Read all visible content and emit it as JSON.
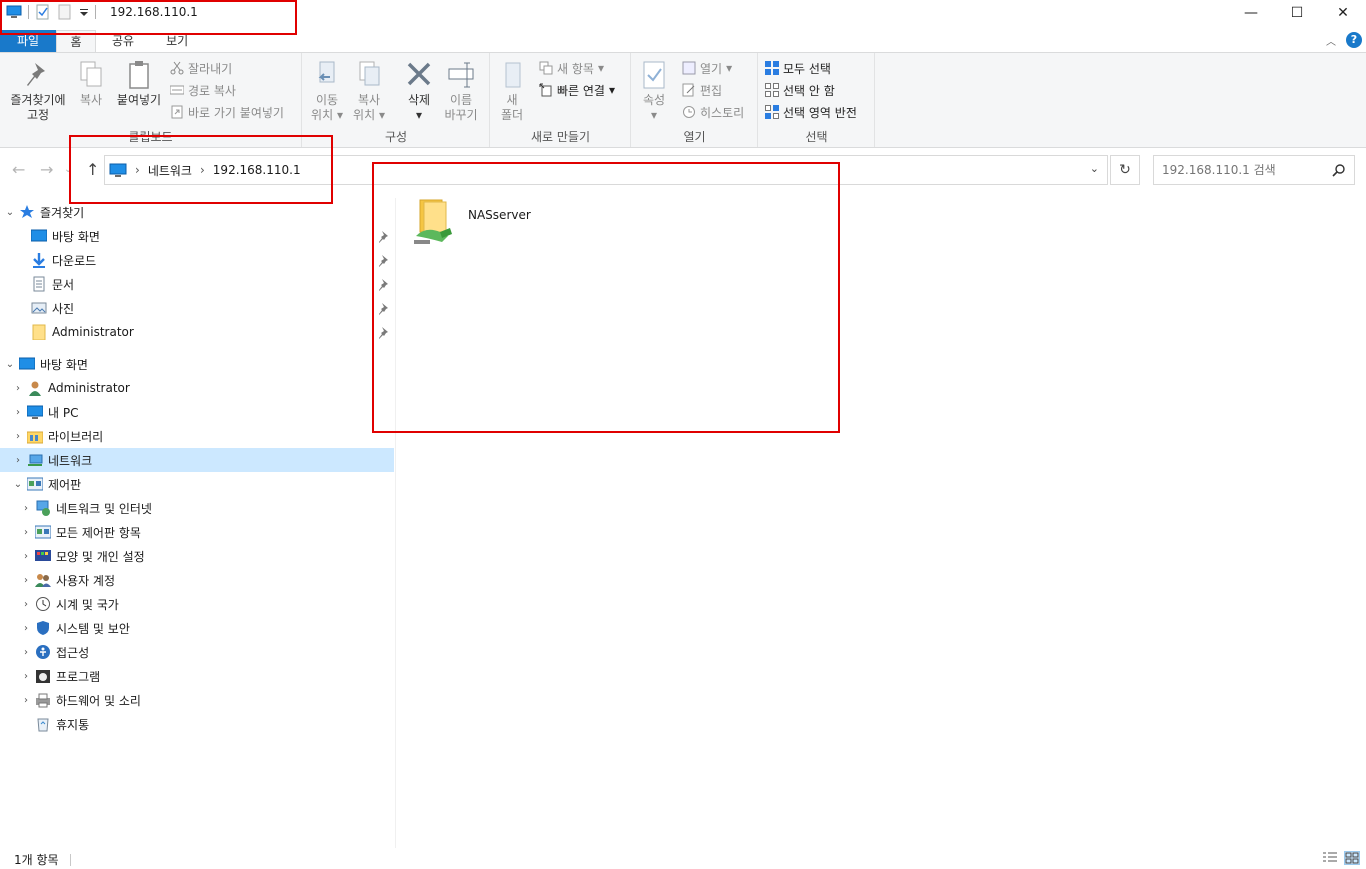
{
  "window": {
    "title": "192.168.110.1",
    "controls": {
      "minimize": "—",
      "maximize": "☐",
      "close": "✕"
    }
  },
  "tabs": [
    {
      "label": "파일"
    },
    {
      "label": "홈"
    },
    {
      "label": "공유"
    },
    {
      "label": "보기"
    }
  ],
  "ribbon": {
    "clipboard": {
      "label": "클립보드",
      "pin_line1": "즐겨찾기에",
      "pin_line2": "고정",
      "copy": "복사",
      "paste": "붙여넣기",
      "cut": "잘라내기",
      "copy_path": "경로 복사",
      "paste_shortcut": "바로 가기 붙여넣기"
    },
    "organize": {
      "label": "구성",
      "move_line1": "이동",
      "move_line2": "위치",
      "copyto_line1": "복사",
      "copyto_line2": "위치",
      "delete": "삭제",
      "rename_line1": "이름",
      "rename_line2": "바꾸기"
    },
    "new": {
      "label": "새로 만들기",
      "folder_line1": "새",
      "folder_line2": "폴더",
      "new_item": "새 항목",
      "easy_access": "빠른 연결"
    },
    "open": {
      "label": "열기",
      "properties": "속성",
      "open": "열기",
      "edit": "편집",
      "history": "히스토리"
    },
    "select": {
      "label": "선택",
      "select_all": "모두 선택",
      "select_none": "선택 안 함",
      "invert": "선택 영역 반전"
    }
  },
  "address": {
    "segments": [
      "네트워크",
      "192.168.110.1"
    ],
    "search_placeholder": "192.168.110.1 검색"
  },
  "nav": {
    "quick_access": "즐겨찾기",
    "quick_items": [
      "바탕 화면",
      "다운로드",
      "문서",
      "사진",
      "Administrator"
    ],
    "desktop": "바탕 화면",
    "desktop_items": [
      "Administrator",
      "내 PC",
      "라이브러리",
      "네트워크",
      "제어판"
    ],
    "control_panel_items": [
      "네트워크 및 인터넷",
      "모든 제어판 항목",
      "모양 및 개인 설정",
      "사용자 계정",
      "시계 및 국가",
      "시스템 및 보안",
      "접근성",
      "프로그램",
      "하드웨어 및 소리"
    ],
    "recycle_bin": "휴지통"
  },
  "content": {
    "items": [
      {
        "name": "NASserver"
      }
    ]
  },
  "status": {
    "count": "1개 항목"
  },
  "colors": {
    "accent": "#1979ca",
    "selected": "#cce8ff",
    "highlight_box": "#e00000"
  }
}
